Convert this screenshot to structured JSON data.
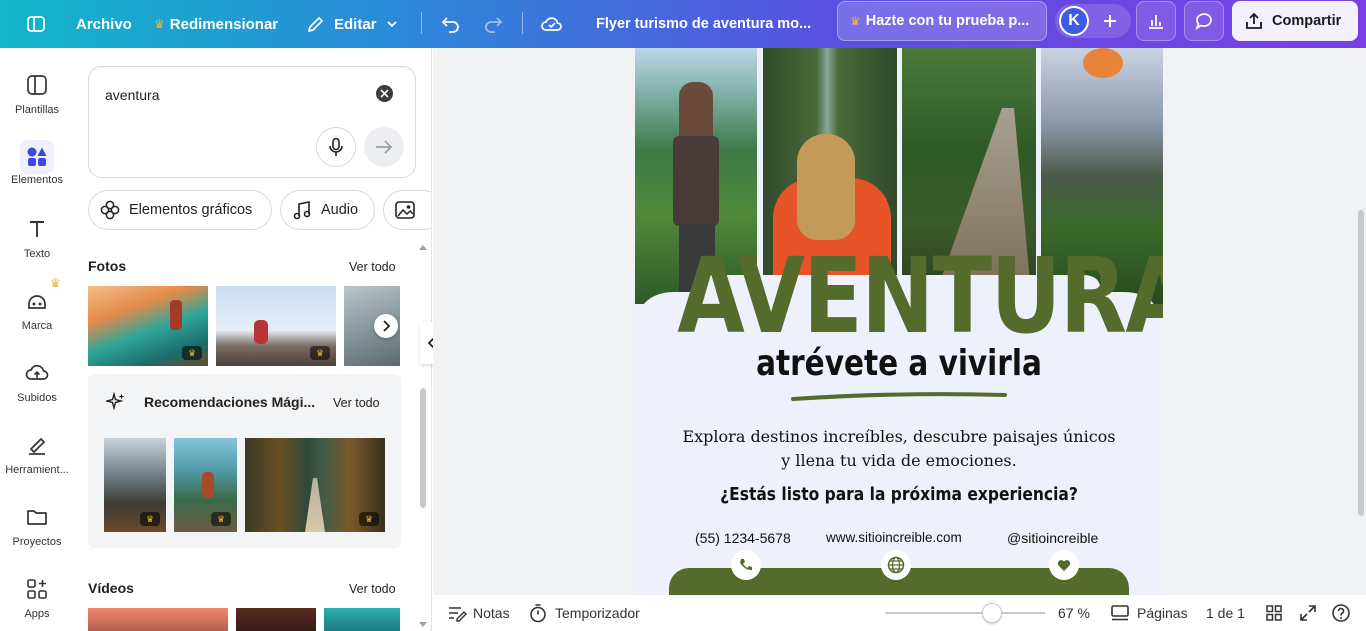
{
  "topbar": {
    "file_label": "Archivo",
    "resize_label": "Redimensionar",
    "edit_label": "Editar",
    "doc_title": "Flyer turismo de aventura mo...",
    "trial_label": "Hazte con tu prueba p...",
    "avatar_initial": "K",
    "share_label": "Compartir"
  },
  "rail": {
    "items": [
      {
        "label": "Plantillas"
      },
      {
        "label": "Elementos"
      },
      {
        "label": "Texto"
      },
      {
        "label": "Marca"
      },
      {
        "label": "Subidos"
      },
      {
        "label": "Herramient..."
      },
      {
        "label": "Proyectos"
      },
      {
        "label": "Apps"
      }
    ]
  },
  "panel": {
    "search_value": "aventura",
    "chips": [
      {
        "label": "Elementos gráficos"
      },
      {
        "label": "Audio"
      }
    ],
    "photos_title": "Fotos",
    "photos_see_all": "Ver todo",
    "magic_title": "Recomendaciones Mági...",
    "magic_see_all": "Ver todo",
    "videos_title": "Vídeos",
    "videos_see_all": "Ver todo"
  },
  "flyer": {
    "headline": "AVENTURA",
    "tagline": "atrévete a vivirla",
    "body_line1": "Explora destinos increíbles, descubre paisajes únicos",
    "body_line2": "y llena tu vida de emociones.",
    "question": "¿Estás listo para la próxima experiencia?",
    "phone": "(55) 1234-5678",
    "website": "www.sitioincreible.com",
    "social": "@sitioincreible"
  },
  "bottombar": {
    "notes_label": "Notas",
    "timer_label": "Temporizador",
    "zoom_text": "67 %",
    "zoom_fraction": 0.67,
    "pages_label": "Páginas",
    "page_indicator": "1 de 1"
  },
  "colors": {
    "accent_green": "#546b2c",
    "flyer_bg": "#eef0fb",
    "brand_purple": "#7a3fe4",
    "brand_teal": "#12b6c9"
  }
}
